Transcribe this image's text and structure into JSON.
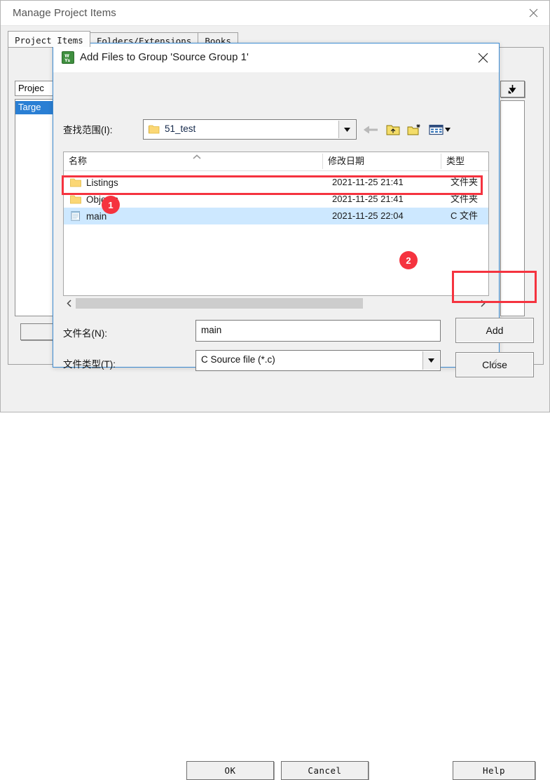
{
  "main_window": {
    "title": "Manage Project Items",
    "close_icon": "close-icon",
    "tabs": [
      {
        "label": "Project Items",
        "active": true
      },
      {
        "label": "Folders/Extensions",
        "active": false
      },
      {
        "label": "Books",
        "active": false
      }
    ],
    "project_combo_value": "Projec",
    "project_list_selected": "Targe",
    "move_button_icon": "down-arrow-icon",
    "buttons": {
      "ok": "OK",
      "cancel": "Cancel",
      "help": "Help"
    }
  },
  "file_dialog": {
    "title": "Add Files to Group 'Source Group 1'",
    "app_icon": "keil-uvision-icon",
    "close_icon": "close-icon",
    "lookin": {
      "label": "查找范围(I):",
      "value": "51_test",
      "folder_icon": "folder-icon",
      "dropdown_icon": "chevron-down-icon"
    },
    "toolbar": [
      {
        "name": "back-icon",
        "title": "back"
      },
      {
        "name": "up-folder-icon",
        "title": "up one level"
      },
      {
        "name": "new-folder-icon",
        "title": "new folder"
      },
      {
        "name": "view-mode-icon",
        "title": "views"
      }
    ],
    "file_list": {
      "columns": [
        "名称",
        "修改日期",
        "类型"
      ],
      "sort_indicator": "sort-ascending-caret",
      "rows": [
        {
          "icon": "folder-icon",
          "name": "Listings",
          "date": "2021-11-25 21:41",
          "type": "文件夹",
          "selected": false
        },
        {
          "icon": "folder-icon",
          "name": "Objects",
          "date": "2021-11-25 21:41",
          "type": "文件夹",
          "selected": false
        },
        {
          "icon": "c-file-icon",
          "name": "main",
          "date": "2021-11-25 22:04",
          "type": "C 文件",
          "selected": true
        }
      ],
      "hscroll": {
        "left_icon": "chevron-left-icon",
        "right_icon": "chevron-right-icon"
      }
    },
    "filename": {
      "label": "文件名(N):",
      "value": "main",
      "placeholder": ""
    },
    "filetype": {
      "label": "文件类型(T):",
      "value": "C Source file (*.c)",
      "dropdown_icon": "chevron-down-icon"
    },
    "buttons": {
      "add": "Add",
      "close": "Close"
    },
    "resize_grip": "resize-grip-icon"
  },
  "annotations": {
    "badge_1": "1",
    "badge_2": "2",
    "highlight_color": "#f5333f"
  },
  "colors": {
    "selection_blue": "#cde8ff",
    "tree_selection": "#2a7fd4",
    "dialog_border": "#3b8ad1",
    "window_bg": "#f0f0f0"
  }
}
